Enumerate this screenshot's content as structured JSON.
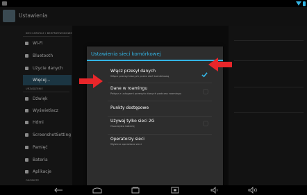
{
  "window": {
    "title": "Ustawienia"
  },
  "sidebar": {
    "section_1": "SIECI ZWYKLE I BEZPRZEWODOWE",
    "section_2": "URZADZENIE",
    "section_3": "OSOBISTE",
    "items": [
      {
        "label": "Wi-Fi",
        "icon": "wifi-icon"
      },
      {
        "label": "Bluetooth",
        "icon": "bluetooth-icon"
      },
      {
        "label": "Użycie danych",
        "icon": "data-usage-icon"
      },
      {
        "label": "Więcej...",
        "icon": ""
      },
      {
        "label": "Dźwięk",
        "icon": "sound-icon"
      },
      {
        "label": "Wyświetlacz",
        "icon": "display-icon"
      },
      {
        "label": "Hdmi",
        "icon": "hdmi-icon"
      },
      {
        "label": "ScreenshotSetting",
        "icon": "screenshot-icon"
      },
      {
        "label": "Pamięć",
        "icon": "storage-icon"
      },
      {
        "label": "Bateria",
        "icon": "battery-icon"
      },
      {
        "label": "Aplikacje",
        "icon": "apps-icon"
      }
    ]
  },
  "dialog": {
    "title": "Ustawienia sieci komórkowej",
    "rows": [
      {
        "title": "Włącz przesył danych",
        "subtitle": "Włącz przesył danych przez sieć komórkową",
        "checked": true
      },
      {
        "title": "Dane w roamingu",
        "subtitle": "Połącz z usługami przesyłu danych podczas roamingu",
        "checked": false
      },
      {
        "title": "Punkty dostępowe",
        "subtitle": ""
      },
      {
        "title": "Używaj tylko sieci 2G",
        "subtitle": "Oszczędza baterię",
        "checked": false
      },
      {
        "title": "Operatorzy sieci",
        "subtitle": "Wybierz operatora sieci"
      }
    ]
  },
  "colors": {
    "accent": "#33b5e5",
    "arrow": "#e8262a",
    "dialog_bg": "#2d2d2d"
  },
  "navbar": {
    "buttons": [
      "back-icon",
      "home-icon",
      "recent-apps-icon",
      "screenshot-icon",
      "volume-down-icon",
      "volume-up-icon"
    ]
  }
}
